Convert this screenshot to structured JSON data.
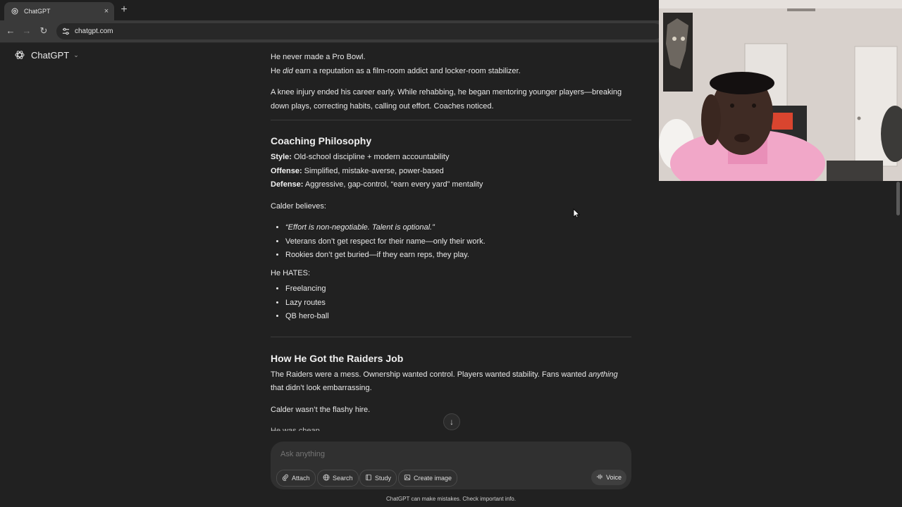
{
  "browser": {
    "tab_title": "ChatGPT",
    "tab_close": "×",
    "new_tab": "+",
    "url": "chatgpt.com",
    "back": "←",
    "forward": "→",
    "reload": "↻"
  },
  "app": {
    "name": "ChatGPT",
    "chevron": "⌄"
  },
  "conversation": {
    "intro_line1": "He never made a Pro Bowl.",
    "intro_line2_pre": "He ",
    "intro_line2_em": "did",
    "intro_line2_post": " earn a reputation as a film-room addict and locker-room stabilizer.",
    "intro_para": "A knee injury ended his career early. While rehabbing, he began mentoring younger players—breaking down plays, correcting habits, calling out effort. Coaches noticed.",
    "coaching": {
      "heading": "Coaching Philosophy",
      "style_label": "Style:",
      "style_value": " Old-school discipline + modern accountability",
      "offense_label": "Offense:",
      "offense_value": " Simplified, mistake-averse, power-based",
      "defense_label": "Defense:",
      "defense_value": " Aggressive, gap-control, “earn every yard” mentality",
      "believes_intro": "Calder believes:",
      "beliefs": [
        "“Effort is non-negotiable. Talent is optional.”",
        "Veterans don’t get respect for their name—only their work.",
        "Rookies don’t get buried—if they earn reps, they play."
      ],
      "hates_intro": "He HATES:",
      "hates": [
        "Freelancing",
        "Lazy routes",
        "QB hero-ball"
      ]
    },
    "raiders": {
      "heading": "How He Got the Raiders Job",
      "para1_pre": "The Raiders were a mess. Ownership wanted control. Players wanted stability. Fans wanted ",
      "para1_em": "anything",
      "para1_post": " that didn’t look embarrassing.",
      "para2": "Calder wasn’t the flashy hire.",
      "para3": "He was cheap."
    }
  },
  "composer": {
    "placeholder": "Ask anything",
    "attach": "Attach",
    "search": "Search",
    "study": "Study",
    "create_image": "Create image",
    "voice": "Voice"
  },
  "scroll_down_glyph": "↓",
  "disclaimer": "ChatGPT can make mistakes. Check important info."
}
